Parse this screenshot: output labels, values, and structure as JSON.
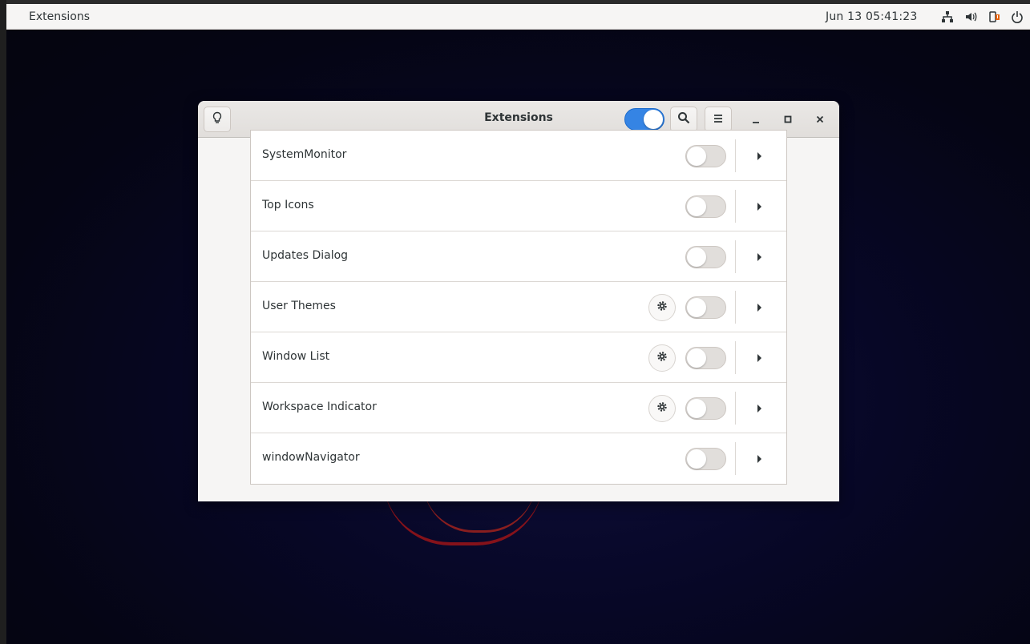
{
  "topbar": {
    "app_name": "Extensions",
    "clock": "Jun 13  05:41:23",
    "tray_icons": [
      "network-icon",
      "volume-icon",
      "battery-icon",
      "power-icon"
    ]
  },
  "window": {
    "title": "Extensions",
    "master_switch_on": true,
    "buttons": {
      "tips": "lightbulb-icon",
      "search": "search-icon",
      "menu": "hamburger-menu-icon",
      "minimize": "minimize-icon",
      "maximize": "maximize-icon",
      "close": "close-icon"
    }
  },
  "extensions": [
    {
      "name": "SystemMonitor",
      "has_settings": false,
      "enabled": false
    },
    {
      "name": "Top Icons",
      "has_settings": false,
      "enabled": false
    },
    {
      "name": "Updates Dialog",
      "has_settings": false,
      "enabled": false
    },
    {
      "name": "User Themes",
      "has_settings": true,
      "enabled": false
    },
    {
      "name": "Window List",
      "has_settings": true,
      "enabled": false
    },
    {
      "name": "Workspace Indicator",
      "has_settings": true,
      "enabled": false
    },
    {
      "name": "windowNavigator",
      "has_settings": false,
      "enabled": false
    }
  ],
  "colors": {
    "accent": "#3584e4",
    "topbar_bg": "#f6f5f4",
    "desktop_bg": "#070726"
  }
}
